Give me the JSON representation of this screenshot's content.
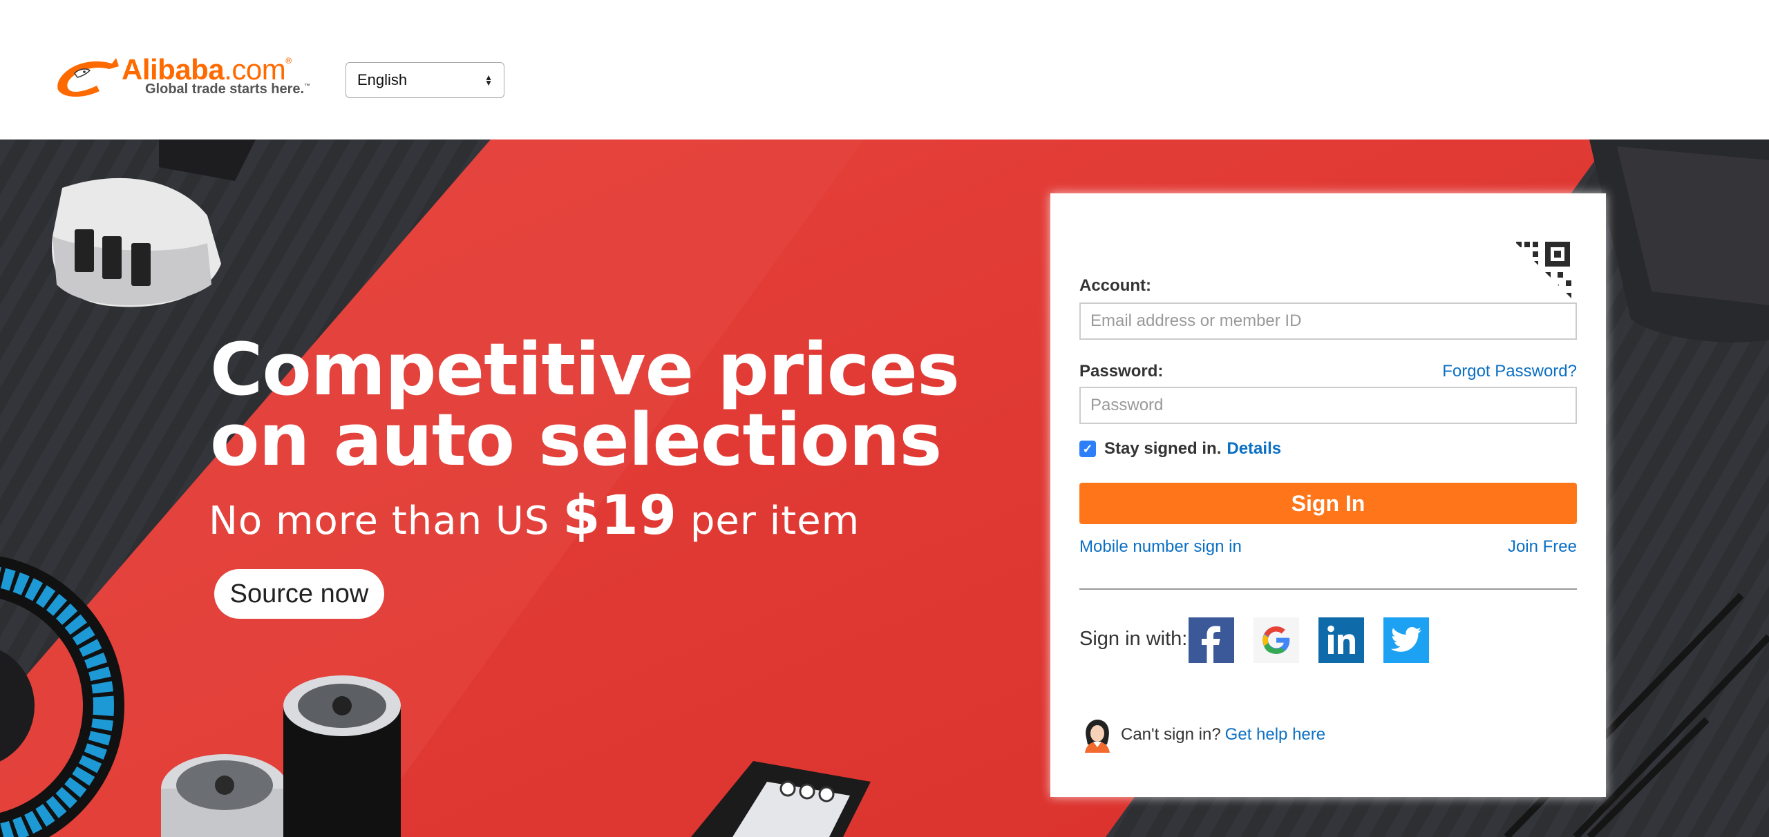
{
  "header": {
    "logo_word": "Alibaba",
    "logo_domain": ".com",
    "logo_reg": "®",
    "logo_tagline": "Global trade starts here.",
    "logo_tm": "™",
    "language": "English"
  },
  "hero": {
    "headline_line1": "Competitive prices",
    "headline_line2": "on auto selections",
    "sub_prefix": "No more than US ",
    "sub_price": "$19",
    "sub_suffix": " per item",
    "cta_label": "Source now"
  },
  "login": {
    "account_label": "Account:",
    "account_placeholder": "Email address or member ID",
    "password_label": "Password:",
    "forgot_link": "Forgot Password?",
    "password_placeholder": "Password",
    "stay_signed_in": "Stay signed in.",
    "stay_checked": true,
    "details_link": "Details",
    "sign_in_button": "Sign In",
    "mobile_link": "Mobile number sign in",
    "join_link": "Join Free",
    "sign_in_with": "Sign in with:",
    "social": [
      "facebook-icon",
      "google-icon",
      "linkedin-icon",
      "twitter-icon"
    ],
    "help_prefix": "Can't sign in?",
    "help_link": "Get help here"
  },
  "colors": {
    "brand_orange": "#ff6a00",
    "button_orange": "#ff7519",
    "link_blue": "#0b6fc3",
    "hero_red": "#e23b36",
    "hero_dark": "#2a2b2f"
  }
}
